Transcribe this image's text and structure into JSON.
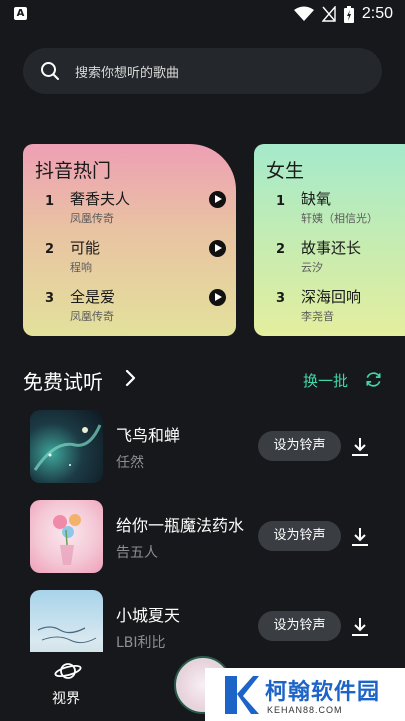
{
  "status_bar": {
    "left_icon": "A",
    "time": "2:50",
    "icons": [
      "wifi-icon",
      "signal-icon",
      "battery-icon"
    ]
  },
  "search": {
    "placeholder": "搜索你想听的歌曲",
    "icon": "search-icon"
  },
  "charts": [
    {
      "title": "抖音热门",
      "items": [
        {
          "rank": "1",
          "name": "奢香夫人",
          "artist": "凤凰传奇"
        },
        {
          "rank": "2",
          "name": "可能",
          "artist": "程响"
        },
        {
          "rank": "3",
          "name": "全是爱",
          "artist": "凤凰传奇"
        }
      ]
    },
    {
      "title": "女生",
      "items": [
        {
          "rank": "1",
          "name": "缺氧",
          "artist": "轩姨（相信光）"
        },
        {
          "rank": "2",
          "name": "故事还长",
          "artist": "云汐"
        },
        {
          "rank": "3",
          "name": "深海回响",
          "artist": "李尧音"
        }
      ]
    }
  ],
  "free_trial": {
    "title": "免费试听",
    "refresh_label": "换一批",
    "accent_color": "#40d8a6",
    "songs": [
      {
        "title": "飞鸟和蝉",
        "artist": "任然",
        "action": "设为铃声"
      },
      {
        "title": "给你一瓶魔法药水",
        "artist": "告五人",
        "action": "设为铃声"
      },
      {
        "title": "小城夏天",
        "artist": "LBI利比",
        "action": "设为铃声"
      }
    ]
  },
  "bottom_nav": {
    "left_label": "视界"
  },
  "watermark": {
    "name": "柯翰软件园",
    "url": "KEHAN88.COM"
  }
}
